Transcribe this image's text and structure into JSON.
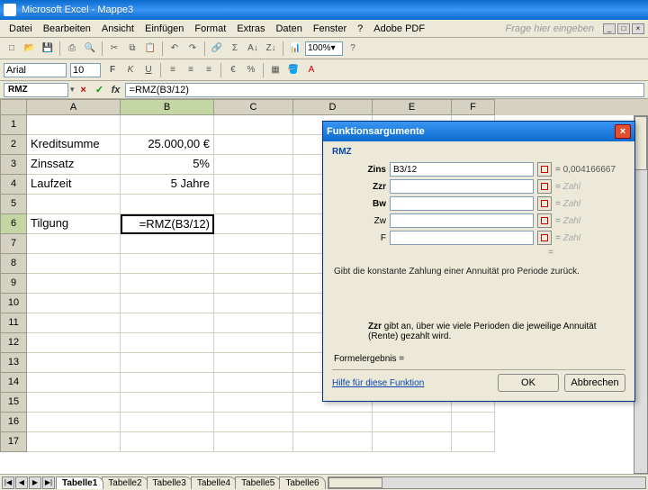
{
  "titlebar": {
    "app": "Microsoft Excel",
    "doc": "Mappe3"
  },
  "menu": {
    "datei": "Datei",
    "bearbeiten": "Bearbeiten",
    "ansicht": "Ansicht",
    "einfuegen": "Einfügen",
    "format": "Format",
    "extras": "Extras",
    "daten": "Daten",
    "fenster": "Fenster",
    "hilfe": "?",
    "adobe": "Adobe PDF",
    "ask": "Frage hier eingeben"
  },
  "toolbar": {
    "zoom": "100%"
  },
  "toolbar2": {
    "font": "Arial",
    "size": "10"
  },
  "formula": {
    "name": "RMZ",
    "text": "=RMZ(B3/12)"
  },
  "cells": {
    "A2": "Kreditsumme",
    "B2": "25.000,00 €",
    "A3": "Zinssatz",
    "B3": "5%",
    "A4": "Laufzeit",
    "B4": "5 Jahre",
    "A6": "Tilgung",
    "B6": "=RMZ(B3/12)"
  },
  "cols": [
    "A",
    "B",
    "C",
    "D",
    "E",
    "F"
  ],
  "tabs": {
    "nav": [
      "|◀",
      "◀",
      "▶",
      "▶|"
    ],
    "items": [
      "Tabelle1",
      "Tabelle2",
      "Tabelle3",
      "Tabelle4",
      "Tabelle5",
      "Tabelle6"
    ]
  },
  "dialog": {
    "title": "Funktionsargumente",
    "fn": "RMZ",
    "args": {
      "zins": {
        "label": "Zins",
        "value": "B3/12",
        "result": "= 0,004166667"
      },
      "zzr": {
        "label": "Zzr",
        "value": "",
        "result": "= Zahl"
      },
      "bw": {
        "label": "Bw",
        "value": "",
        "result": "= Zahl"
      },
      "zw": {
        "label": "Zw",
        "value": "",
        "result": "= Zahl"
      },
      "f": {
        "label": "F",
        "value": "",
        "result": "= Zahl"
      }
    },
    "desc": "Gibt die konstante Zahlung einer Annuität pro Periode zurück.",
    "arg_desc_label": "Zzr",
    "arg_desc": "gibt an, über wie viele Perioden die jeweilige Annuität (Rente) gezahlt wird.",
    "result_label": "Formelergebnis =",
    "help": "Hilfe für diese Funktion",
    "ok": "OK",
    "cancel": "Abbrechen"
  }
}
